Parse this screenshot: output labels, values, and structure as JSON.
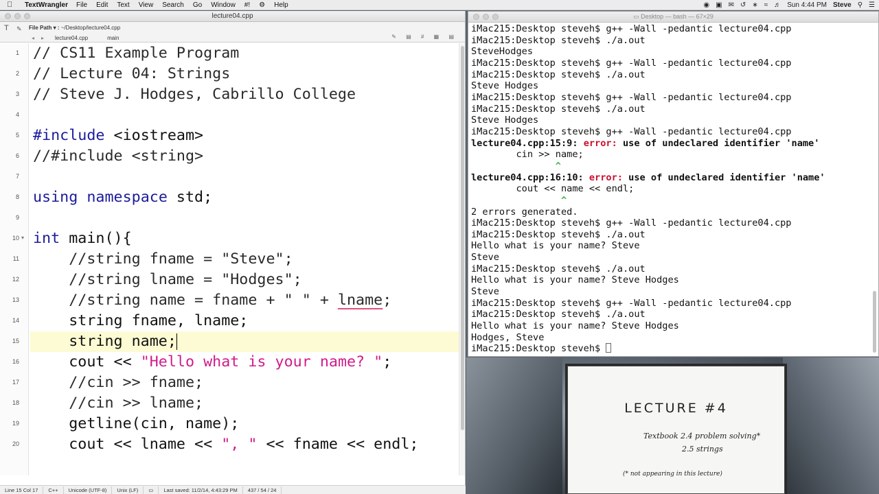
{
  "menubar": {
    "app_name": "TextWrangler",
    "items": [
      "File",
      "Edit",
      "Text",
      "View",
      "Search",
      "Go",
      "Window",
      "#!",
      "Help"
    ],
    "clock": "Sun 4:44 PM",
    "user": "Steve"
  },
  "editor": {
    "window_title": "lecture04.cpp",
    "file_path_label": "File Path ▾ :",
    "file_path": "~/Desktop/lecture04.cpp",
    "doc_name": "lecture04.cpp",
    "function_popup": "main",
    "lines": [
      {
        "num": "1",
        "text": "// CS11 Example Program"
      },
      {
        "num": "2",
        "text": "// Lecture 04: Strings"
      },
      {
        "num": "3",
        "text": "// Steve J. Hodges, Cabrillo College"
      },
      {
        "num": "4",
        "text": ""
      },
      {
        "num": "5",
        "text": "#include <iostream>"
      },
      {
        "num": "6",
        "text": "//#include <string>"
      },
      {
        "num": "7",
        "text": ""
      },
      {
        "num": "8",
        "text": "using namespace std;"
      },
      {
        "num": "9",
        "text": ""
      },
      {
        "num": "10",
        "text": "int main(){"
      },
      {
        "num": "11",
        "text": "    //string fname = \"Steve\";"
      },
      {
        "num": "12",
        "text": "    //string lname = \"Hodges\";"
      },
      {
        "num": "13",
        "text": "    //string name = fname + \" \" + lname;"
      },
      {
        "num": "14",
        "text": "    string fname, lname;"
      },
      {
        "num": "15",
        "text": "    string name;"
      },
      {
        "num": "16",
        "text": "    cout << \"Hello what is your name? \";"
      },
      {
        "num": "17",
        "text": "    //cin >> fname;"
      },
      {
        "num": "18",
        "text": "    //cin >> lname;"
      },
      {
        "num": "19",
        "text": "    getline(cin, name);"
      },
      {
        "num": "20",
        "text": "    cout << lname << \", \" << fname << endl;"
      }
    ],
    "status": {
      "position": "Line 15 Col 17",
      "language": "C++",
      "encoding": "Unicode (UTF-8)",
      "line_endings": "Unix (LF)",
      "last_saved": "Last saved: 11/2/14, 4:43:29 PM",
      "counts": "437 / 54 / 24"
    }
  },
  "terminal": {
    "window_title": "Desktop — bash — 67×29",
    "lines": [
      "iMac215:Desktop steveh$ g++ -Wall -pedantic lecture04.cpp",
      "iMac215:Desktop steveh$ ./a.out",
      "SteveHodges",
      "iMac215:Desktop steveh$ g++ -Wall -pedantic lecture04.cpp",
      "iMac215:Desktop steveh$ ./a.out",
      "Steve Hodges",
      "iMac215:Desktop steveh$ g++ -Wall -pedantic lecture04.cpp",
      "iMac215:Desktop steveh$ ./a.out",
      "Steve Hodges",
      "iMac215:Desktop steveh$ g++ -Wall -pedantic lecture04.cpp",
      "lecture04.cpp:15:9: error: use of undeclared identifier 'name'",
      "        cin >> name;",
      "               ^",
      "lecture04.cpp:16:10: error: use of undeclared identifier 'name'",
      "        cout << name << endl;",
      "                ^",
      "2 errors generated.",
      "iMac215:Desktop steveh$ g++ -Wall -pedantic lecture04.cpp",
      "iMac215:Desktop steveh$ ./a.out",
      "Hello what is your name? Steve",
      "Steve",
      "iMac215:Desktop steveh$ ./a.out",
      "Hello what is your name? Steve Hodges",
      "Steve",
      "iMac215:Desktop steveh$ g++ -Wall -pedantic lecture04.cpp",
      "iMac215:Desktop steveh$ ./a.out",
      "Hello what is your name? Steve Hodges",
      "Hodges, Steve",
      "iMac215:Desktop steveh$ "
    ]
  },
  "card": {
    "title": "LECTURE #4",
    "line1": "Textbook 2.4 problem solving*",
    "line2": "2.5 strings",
    "note": "(* not appearing in this lecture)"
  },
  "colors": {
    "keyword": "#1b1b9c",
    "string": "#d01b8c",
    "error": "#c8102e",
    "current_line": "#fdfbd3"
  }
}
